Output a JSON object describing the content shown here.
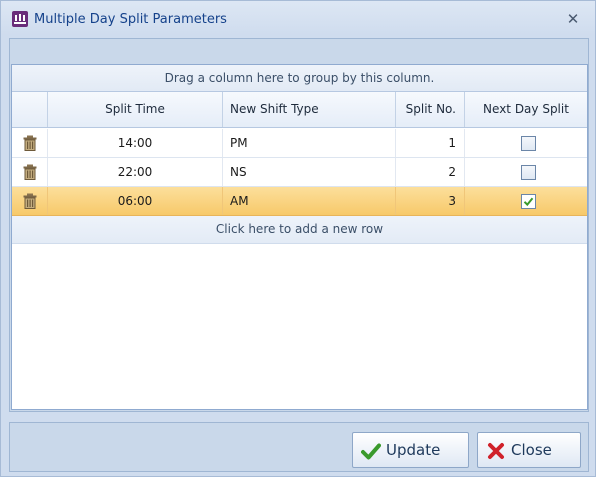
{
  "window": {
    "title": "Multiple Day Split Parameters",
    "close_glyph": "✕"
  },
  "grid": {
    "group_panel_text": "Drag a column here to group by this column.",
    "columns": [
      "Split Time",
      "New Shift Type",
      "Split No.",
      "Next Day Split"
    ],
    "rows": [
      {
        "split_time": "14:00",
        "shift_type": "PM",
        "split_no": "1",
        "next_day_split": false,
        "selected": false
      },
      {
        "split_time": "22:00",
        "shift_type": "NS",
        "split_no": "2",
        "next_day_split": false,
        "selected": false
      },
      {
        "split_time": "06:00",
        "shift_type": "AM",
        "split_no": "3",
        "next_day_split": true,
        "selected": true
      }
    ],
    "new_row_text": "Click here to add a new row"
  },
  "buttons": {
    "update_label": "Update",
    "close_label": "Close"
  },
  "icons": {
    "app": "app-logo-icon",
    "delete": "trash-icon",
    "update": "checkmark-icon",
    "close": "red-x-icon"
  },
  "colors": {
    "selected_row": "#f9d27e",
    "header_text": "#15428b",
    "check_green": "#3a9a2c",
    "close_red": "#d0212a"
  }
}
